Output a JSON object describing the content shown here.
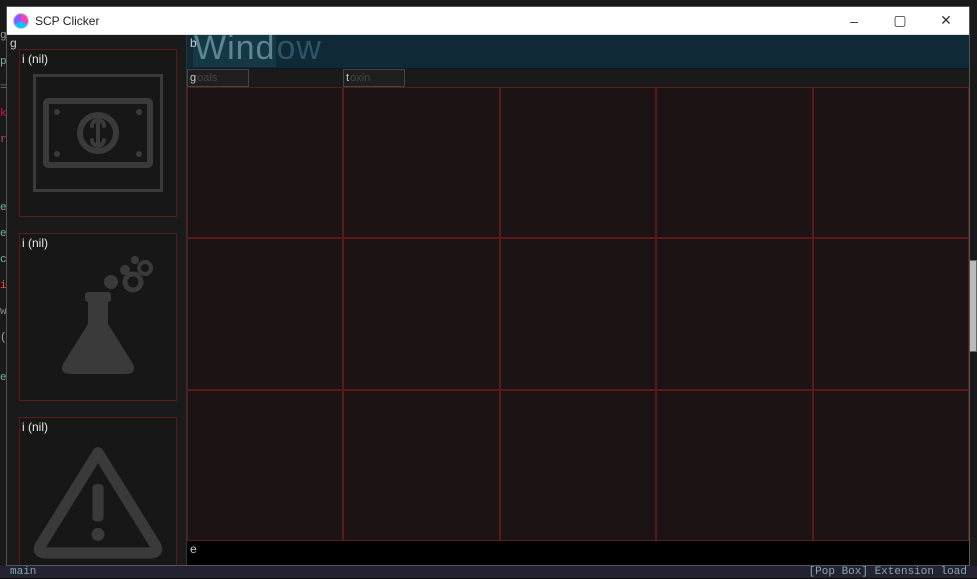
{
  "window": {
    "title": "SCP Clicker"
  },
  "titlebar_controls": {
    "minimize": "–",
    "maximize": "▢",
    "close": "✕"
  },
  "sidebar": {
    "corner_char": "g",
    "items": [
      {
        "label": "i (nil)",
        "icon": "money"
      },
      {
        "label": "i (nil)",
        "icon": "flask"
      },
      {
        "label": "i (nil)",
        "icon": "warning"
      }
    ]
  },
  "main": {
    "corner_char": "b",
    "header_text_sel": "Wind",
    "header_text_rest": "ow",
    "tabs": [
      {
        "pre": "g",
        "rest": "oals"
      },
      {
        "pre": "t",
        "rest": "oxin"
      }
    ],
    "grid": {
      "rows": 3,
      "cols": 5
    },
    "footer_char": "e"
  },
  "background": {
    "strip_tokens": [
      {
        "t": "g",
        "c": "tok-g"
      },
      {
        "t": "p",
        "c": "tok-p"
      },
      {
        "t": "=",
        "c": "tok-eq"
      },
      {
        "t": "k",
        "c": "tok-k"
      },
      {
        "t": "r",
        "c": "tok-r"
      },
      {
        "t": "",
        "c": "tok-g"
      },
      {
        "t": "",
        "c": "tok-g"
      },
      {
        "t": "",
        "c": "tok-g"
      },
      {
        "t": "e",
        "c": "tok-e"
      },
      {
        "t": "e",
        "c": "tok-e"
      },
      {
        "t": "c",
        "c": "tok-c"
      },
      {
        "t": "i",
        "c": "tok-i"
      },
      {
        "t": "w",
        "c": "tok-w"
      },
      {
        "t": "(",
        "c": "tok-paren"
      },
      {
        "t": "",
        "c": "tok-g"
      },
      {
        "t": "e",
        "c": "tok-e"
      }
    ],
    "bottom_left": "main",
    "bottom_right": "[Pop Box]    Extension load"
  }
}
